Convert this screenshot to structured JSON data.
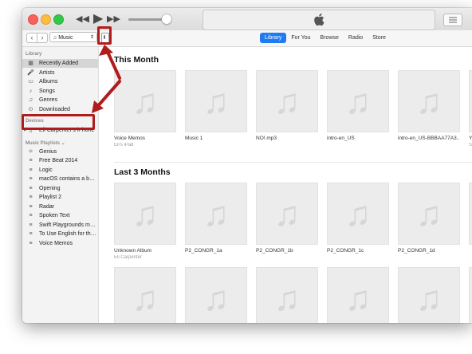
{
  "toolbar": {
    "media_type": "Music",
    "back_glyph": "‹",
    "forward_glyph": "›",
    "tabs": [
      {
        "label": "Library",
        "active": true
      },
      {
        "label": "For You",
        "active": false
      },
      {
        "label": "Browse",
        "active": false
      },
      {
        "label": "Radio",
        "active": false
      },
      {
        "label": "Store",
        "active": false
      }
    ]
  },
  "sidebar": {
    "library_header": "Library",
    "library_items": [
      {
        "label": "Recently Added",
        "icon": "recently-added-icon",
        "selected": true
      },
      {
        "label": "Artists",
        "icon": "artists-icon",
        "selected": false
      },
      {
        "label": "Albums",
        "icon": "albums-icon",
        "selected": false
      },
      {
        "label": "Songs",
        "icon": "songs-icon",
        "selected": false
      },
      {
        "label": "Genres",
        "icon": "genres-icon",
        "selected": false
      },
      {
        "label": "Downloaded",
        "icon": "downloaded-icon",
        "selected": false
      }
    ],
    "devices_header": "Devices",
    "device_name": "Eli Carpenter's iPhone",
    "playlists_header": "Music Playlists ⌄",
    "playlists": [
      "Genius",
      "Free Beat 2014",
      "Logic",
      "macOS contains a buil...",
      "Opening",
      "Playlist 2",
      "Radar",
      "Spoken Text",
      "Swift Playgrounds mu...",
      "To Use English for the...",
      "Voice Memos"
    ]
  },
  "main": {
    "section1_title": "This Month",
    "section1_albums": [
      {
        "title": "Voice Memos",
        "subtitle": "Eli's iPad"
      },
      {
        "title": "Music 1",
        "subtitle": ""
      },
      {
        "title": "NO!.mp3",
        "subtitle": ""
      },
      {
        "title": "intro-en_US",
        "subtitle": ""
      },
      {
        "title": "intro-en_US-BBBAA77A3...",
        "subtitle": ""
      },
      {
        "title": "Yo",
        "subtitle": "Si"
      }
    ],
    "section2_title": "Last 3 Months",
    "section2_albums": [
      {
        "title": "Unknown Album",
        "subtitle": "Eli Carpenter"
      },
      {
        "title": "P2_CONGR_1a",
        "subtitle": ""
      },
      {
        "title": "P2_CONGR_1b",
        "subtitle": ""
      },
      {
        "title": "P2_CONGR_1c",
        "subtitle": ""
      },
      {
        "title": "P2_CONGR_1d",
        "subtitle": ""
      },
      {
        "title": "",
        "subtitle": ""
      }
    ]
  },
  "colors": {
    "accent": "#1f7bf2",
    "annotation": "#b01c1c"
  }
}
